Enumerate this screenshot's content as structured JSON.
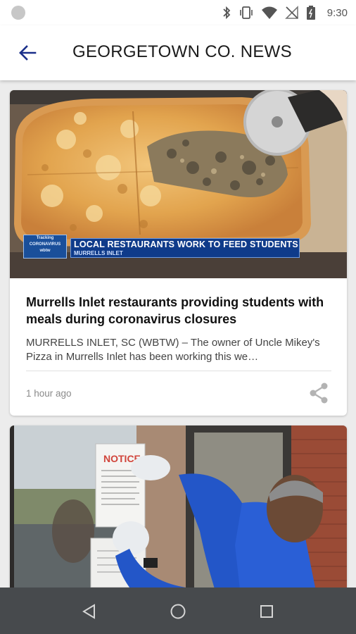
{
  "status_bar": {
    "time": "9:30",
    "icons": [
      "notification-dot-icon",
      "bluetooth-icon",
      "vibrate-icon",
      "wifi-icon",
      "no-signal-icon",
      "battery-icon"
    ]
  },
  "app_bar": {
    "title": "GEORGETOWN CO. NEWS",
    "back_icon": "arrow-left-icon",
    "accent_color": "#1a2f8a"
  },
  "articles": [
    {
      "image": {
        "description_icon": "pizza-photo",
        "logo_lines": [
          "Tracking",
          "CORONAVIRUS",
          "wbtw"
        ],
        "banner_headline": "LOCAL RESTAURANTS WORK TO FEED STUDENTS",
        "banner_location": "MURRELLS INLET"
      },
      "title": "Murrells Inlet restaurants providing students with meals during coronavirus closures",
      "excerpt": "MURRELLS INLET, SC (WBTW) – The owner of Uncle Mikey's Pizza in Murrells Inlet has been working this we…",
      "timestamp": "1 hour ago",
      "share_icon": "share-icon"
    },
    {
      "image": {
        "description_icon": "notice-photo",
        "notice_text": "NOTICE"
      }
    }
  ],
  "nav_bar": {
    "buttons": [
      "back-triangle-icon",
      "home-circle-icon",
      "recents-square-icon"
    ]
  }
}
